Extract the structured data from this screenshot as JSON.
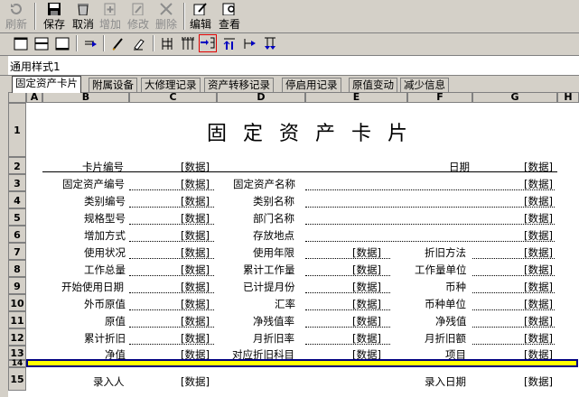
{
  "toolbar": {
    "refresh": "刷新",
    "save": "保存",
    "cancel": "取消",
    "add": "增加",
    "modify": "修改",
    "delete": "删除",
    "edit": "编辑",
    "view": "查看"
  },
  "style_name": "通用样式1",
  "tabs": [
    "固定资产卡片",
    "附属设备",
    "大修理记录",
    "资产转移记录",
    "停启用记录",
    "原值变动",
    "减少信息"
  ],
  "columns": [
    "A",
    "B",
    "C",
    "D",
    "E",
    "F",
    "G",
    "H"
  ],
  "rows": [
    "1",
    "2",
    "3",
    "4",
    "5",
    "6",
    "7",
    "8",
    "9",
    "10",
    "11",
    "12",
    "13",
    "14",
    "15"
  ],
  "card": {
    "title": "固定资产卡片",
    "card_no": "卡片编号",
    "date": "日期",
    "data": "[数据]",
    "asset_code": "固定资产编号",
    "asset_name": "固定资产名称",
    "category_code": "类别编号",
    "category_name": "类别名称",
    "spec": "规格型号",
    "dept": "部门名称",
    "add_method": "增加方式",
    "location": "存放地点",
    "status": "使用状况",
    "years": "使用年限",
    "depr_method": "折旧方法",
    "workload": "工作总量",
    "acc_workload": "累计工作量",
    "workload_unit": "工作量单位",
    "start_date": "开始使用日期",
    "depr_months": "已计提月份",
    "currency": "币种",
    "fc_value": "外币原值",
    "rate": "汇率",
    "currency_unit": "币种单位",
    "orig_value": "原值",
    "residual_rate": "净残值率",
    "residual": "净残值",
    "acc_depr": "累计折旧",
    "monthly_rate": "月折旧率",
    "monthly_amt": "月折旧额",
    "net_value": "净值",
    "depr_account": "对应折旧科目",
    "project": "项目",
    "entered_by": "录入人",
    "entry_date": "录入日期"
  }
}
